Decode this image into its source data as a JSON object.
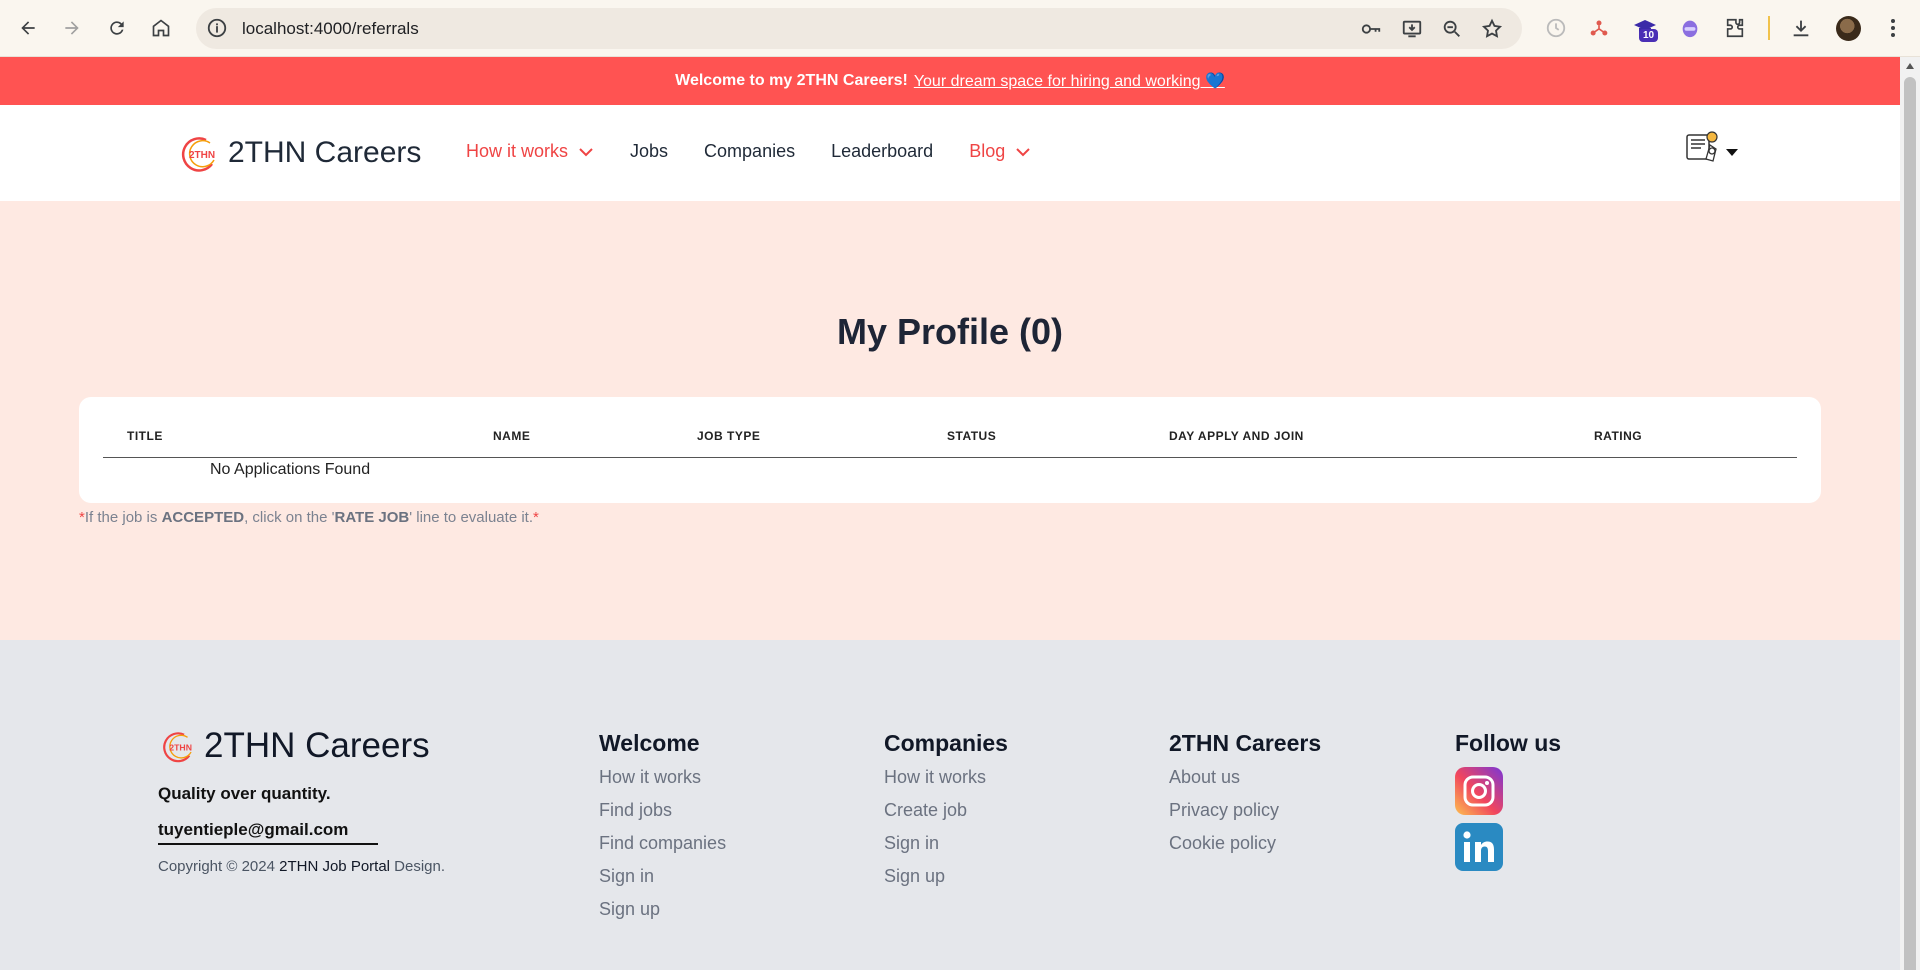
{
  "browser": {
    "url": "localhost:4000/referrals",
    "extension_badge": "10"
  },
  "promo": {
    "bold": "Welcome to my 2THN Careers!",
    "link": "Your dream space for hiring and working 💙"
  },
  "header": {
    "brand": "2THN Careers",
    "logo_mark": "2THN",
    "nav": [
      {
        "label": "How it works",
        "dropdown": true
      },
      {
        "label": "Jobs"
      },
      {
        "label": "Companies"
      },
      {
        "label": "Leaderboard"
      },
      {
        "label": "Blog",
        "dropdown": true
      }
    ]
  },
  "main": {
    "title": "My Profile (0)",
    "columns": [
      "TITLE",
      "NAME",
      "JOB TYPE",
      "STATUS",
      "DAY APPLY AND JOIN",
      "RATING"
    ],
    "empty_text": "No Applications Found",
    "note": {
      "prefix": "*",
      "text1": "If the job is ",
      "accepted": "ACCEPTED",
      "text2": ", click on the '",
      "rate": "RATE JOB",
      "text3": "' line to evaluate it.",
      "suffix": "*"
    }
  },
  "footer": {
    "brand": "2THN Careers",
    "tagline": "Quality over quantity.",
    "email": "tuyentieple@gmail.com",
    "copyright_prefix": "Copyright © 2024 ",
    "copyright_name": "2THN Job Portal",
    "copyright_suffix": " Design.",
    "columns": [
      {
        "title": "Welcome",
        "links": [
          "How it works",
          "Find jobs",
          "Find companies",
          "Sign in",
          "Sign up"
        ]
      },
      {
        "title": "Companies",
        "links": [
          "How it works",
          "Create job",
          "Sign in",
          "Sign up"
        ]
      },
      {
        "title": "2THN Careers",
        "links": [
          "About us",
          "Privacy policy",
          "Cookie policy"
        ]
      }
    ],
    "follow_title": "Follow us",
    "socials": [
      "instagram-icon",
      "linkedin-icon"
    ]
  },
  "colors": {
    "accent": "#ff5352",
    "nav_red": "#ef4444",
    "main_bg": "#fee9e2",
    "footer_bg": "#e5e7eb"
  }
}
